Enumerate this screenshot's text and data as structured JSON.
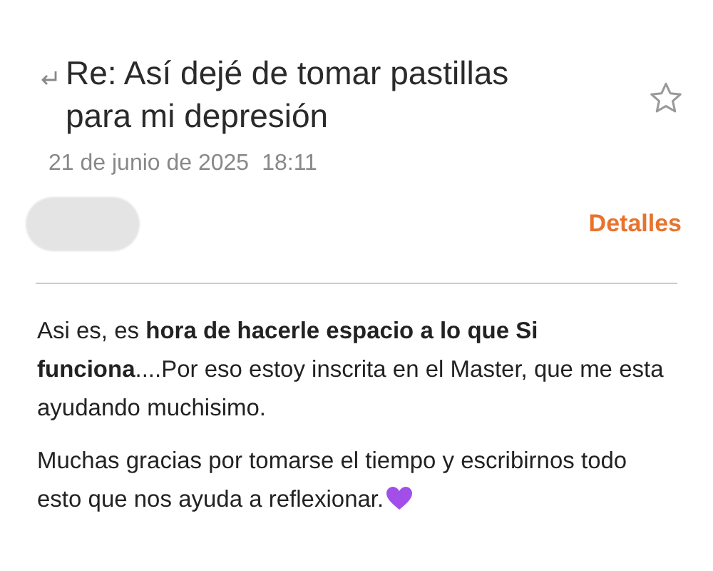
{
  "email": {
    "subject": "Re: Así dejé de tomar pastillas para mi depresión",
    "starred": false,
    "date": "21 de junio de 2025",
    "time": "18:11",
    "details_link": "Detalles",
    "paragraphs": [
      "Asi es, es **hora de hacerle espacio a lo que Si funciona**....Por eso estoy inscrita en el Master, que me esta ayudando muchisimo.",
      "Muchas gracias por tomarse el tiempo y escribirnos todo esto que nos ayuda a reflexionar."
    ]
  }
}
